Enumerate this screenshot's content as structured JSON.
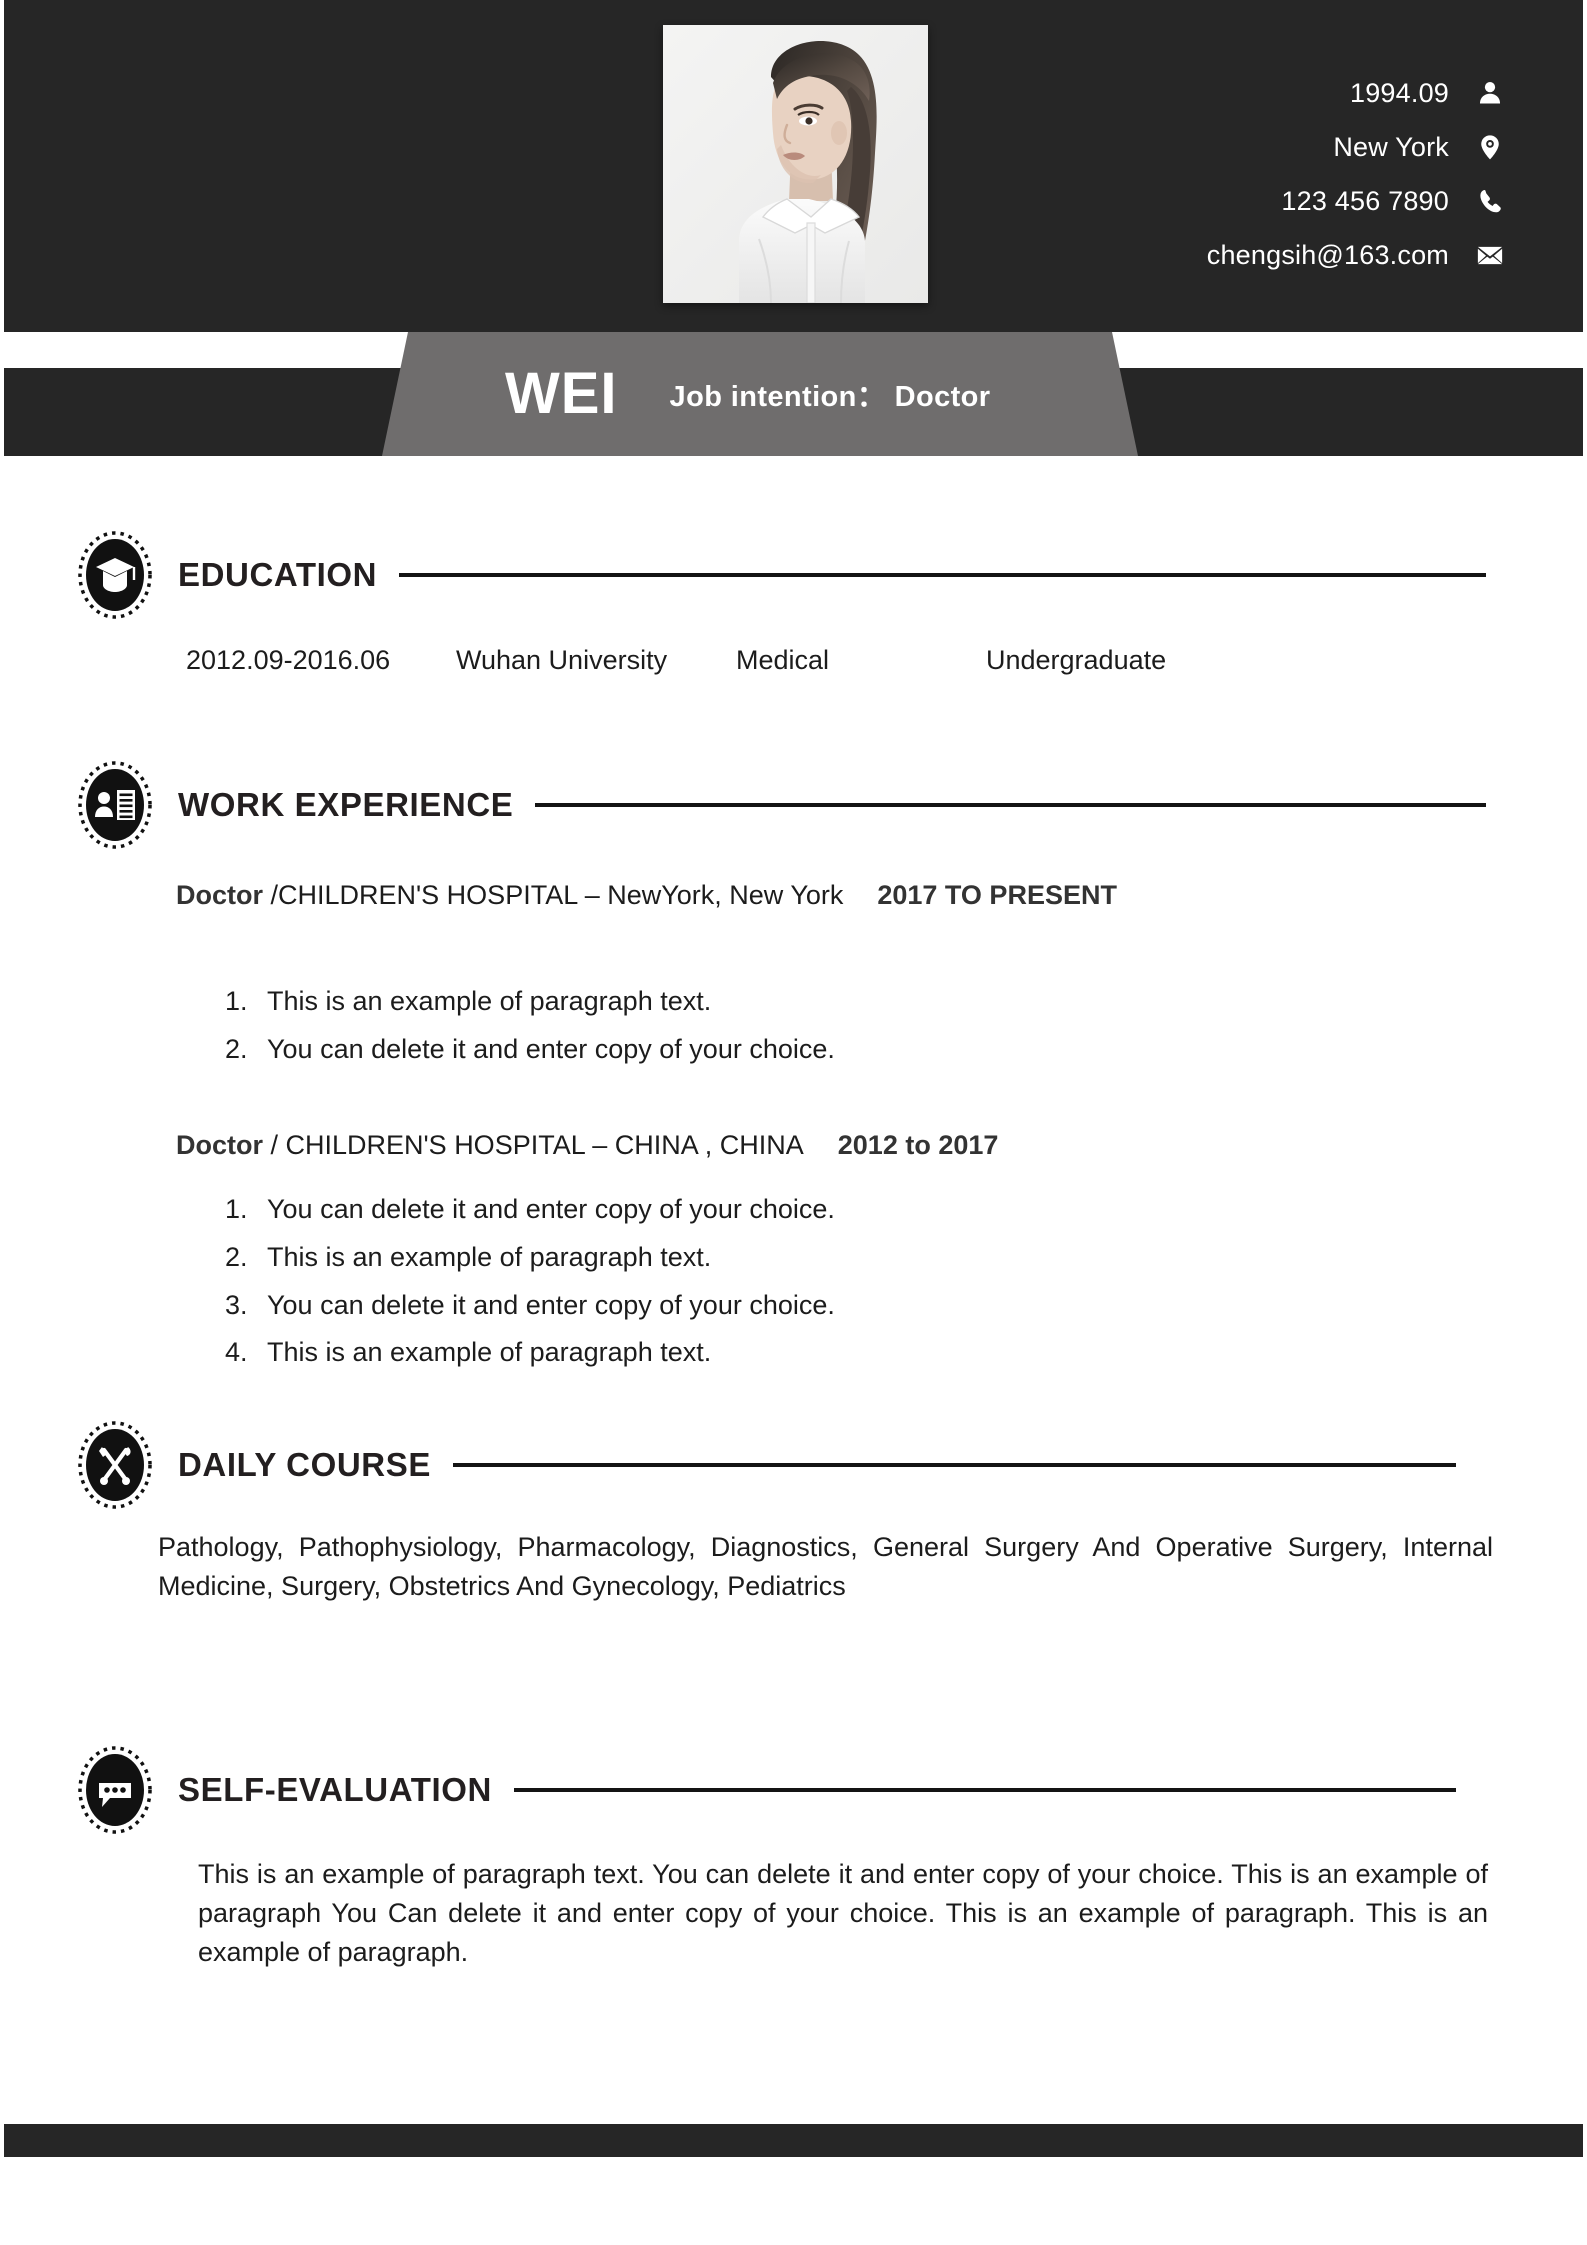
{
  "header": {
    "photo_alt": "portrait-photo",
    "contacts": [
      {
        "icon": "person-icon",
        "value": "1994.09"
      },
      {
        "icon": "location-icon",
        "value": "New York"
      },
      {
        "icon": "phone-icon",
        "value": "123 456 7890"
      },
      {
        "icon": "email-icon",
        "value": "chengsih@163.com"
      }
    ]
  },
  "banner": {
    "name": "WEI",
    "job_intention": "Job intention： Doctor"
  },
  "sections": {
    "education": {
      "title": "EDUCATION",
      "icon": "graduation-cap-icon",
      "entry": {
        "dates": "2012.09-2016.06",
        "school": "Wuhan University",
        "major": "Medical",
        "degree": "Undergraduate"
      }
    },
    "work_experience": {
      "title": "WORK EXPERIENCE",
      "icon": "id-card-icon",
      "jobs": [
        {
          "role": "Doctor",
          "company": " /CHILDREN'S HOSPITAL   –  NewYork, New York",
          "dates": "2017 TO PRESENT",
          "bullets": [
            {
              "num": "1.",
              "text": "This is an example of paragraph text."
            },
            {
              "num": "2.",
              "text": "You can delete it and enter copy of your choice."
            }
          ]
        },
        {
          "role": "Doctor",
          "company": " / CHILDREN'S HOSPITAL  –  CHINA , CHINA",
          "dates": "2012 to 2017",
          "bullets": [
            {
              "num": "1.",
              "text": "You can delete it and enter copy of your choice."
            },
            {
              "num": "2.",
              "text": "This is an example of paragraph text."
            },
            {
              "num": "3.",
              "text": "You can delete it and enter copy of your choice."
            },
            {
              "num": "4.",
              "text": "This is an example of paragraph text."
            }
          ]
        }
      ]
    },
    "daily_course": {
      "title": "DAILY COURSE",
      "icon": "tools-icon",
      "text": "Pathology, Pathophysiology, Pharmacology, Diagnostics, General Surgery And Operative Surgery, Internal Medicine, Surgery, Obstetrics And Gynecology, Pediatrics"
    },
    "self_evaluation": {
      "title": "SELF-EVALUATION",
      "icon": "chat-bubble-icon",
      "text": "This is an example of paragraph text. You can delete it and enter copy of your choice. This is an example of paragraph You Can delete it and enter copy of your choice. This is an example of paragraph. This is an example of paragraph."
    }
  },
  "colors": {
    "dark": "#262626",
    "gray_banner": "#6f6d6d",
    "rule": "#141414",
    "text": "#1c1c1c"
  }
}
